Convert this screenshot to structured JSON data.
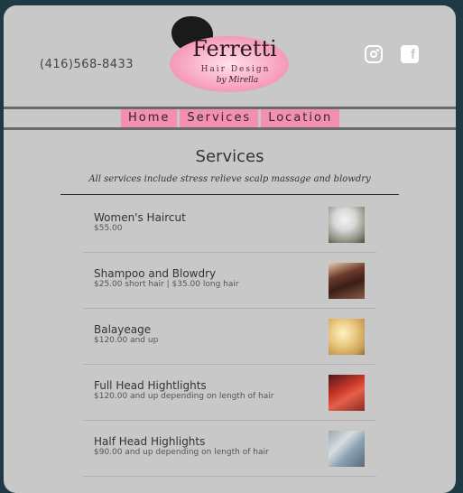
{
  "header": {
    "phone": "(416)568-8433",
    "logo": {
      "name": "Ferretti",
      "tagline": "Hair Design",
      "signature": "by Mirella"
    },
    "social": [
      "instagram-icon",
      "facebook-icon"
    ]
  },
  "nav": {
    "items": [
      "Home",
      "Services",
      "Location"
    ]
  },
  "page": {
    "title": "Services",
    "subtitle": "All services include stress relieve scalp massage and blowdry"
  },
  "services": [
    {
      "name": "Women's Haircut",
      "price": "$55.00"
    },
    {
      "name": "Shampoo and Blowdry",
      "price": "$25.00 short hair | $35.00 long hair"
    },
    {
      "name": "Balayeage",
      "price": "$120.00 and up"
    },
    {
      "name": "Full Head Hightlights",
      "price": "$120.00 and up depending on length of hair"
    },
    {
      "name": "Half Head Highlights",
      "price": "$90.00 and up depending on length of hair"
    }
  ],
  "colors": {
    "accent": "#f48fb1",
    "background": "#c8c8c8",
    "border": "#1f3a44"
  }
}
